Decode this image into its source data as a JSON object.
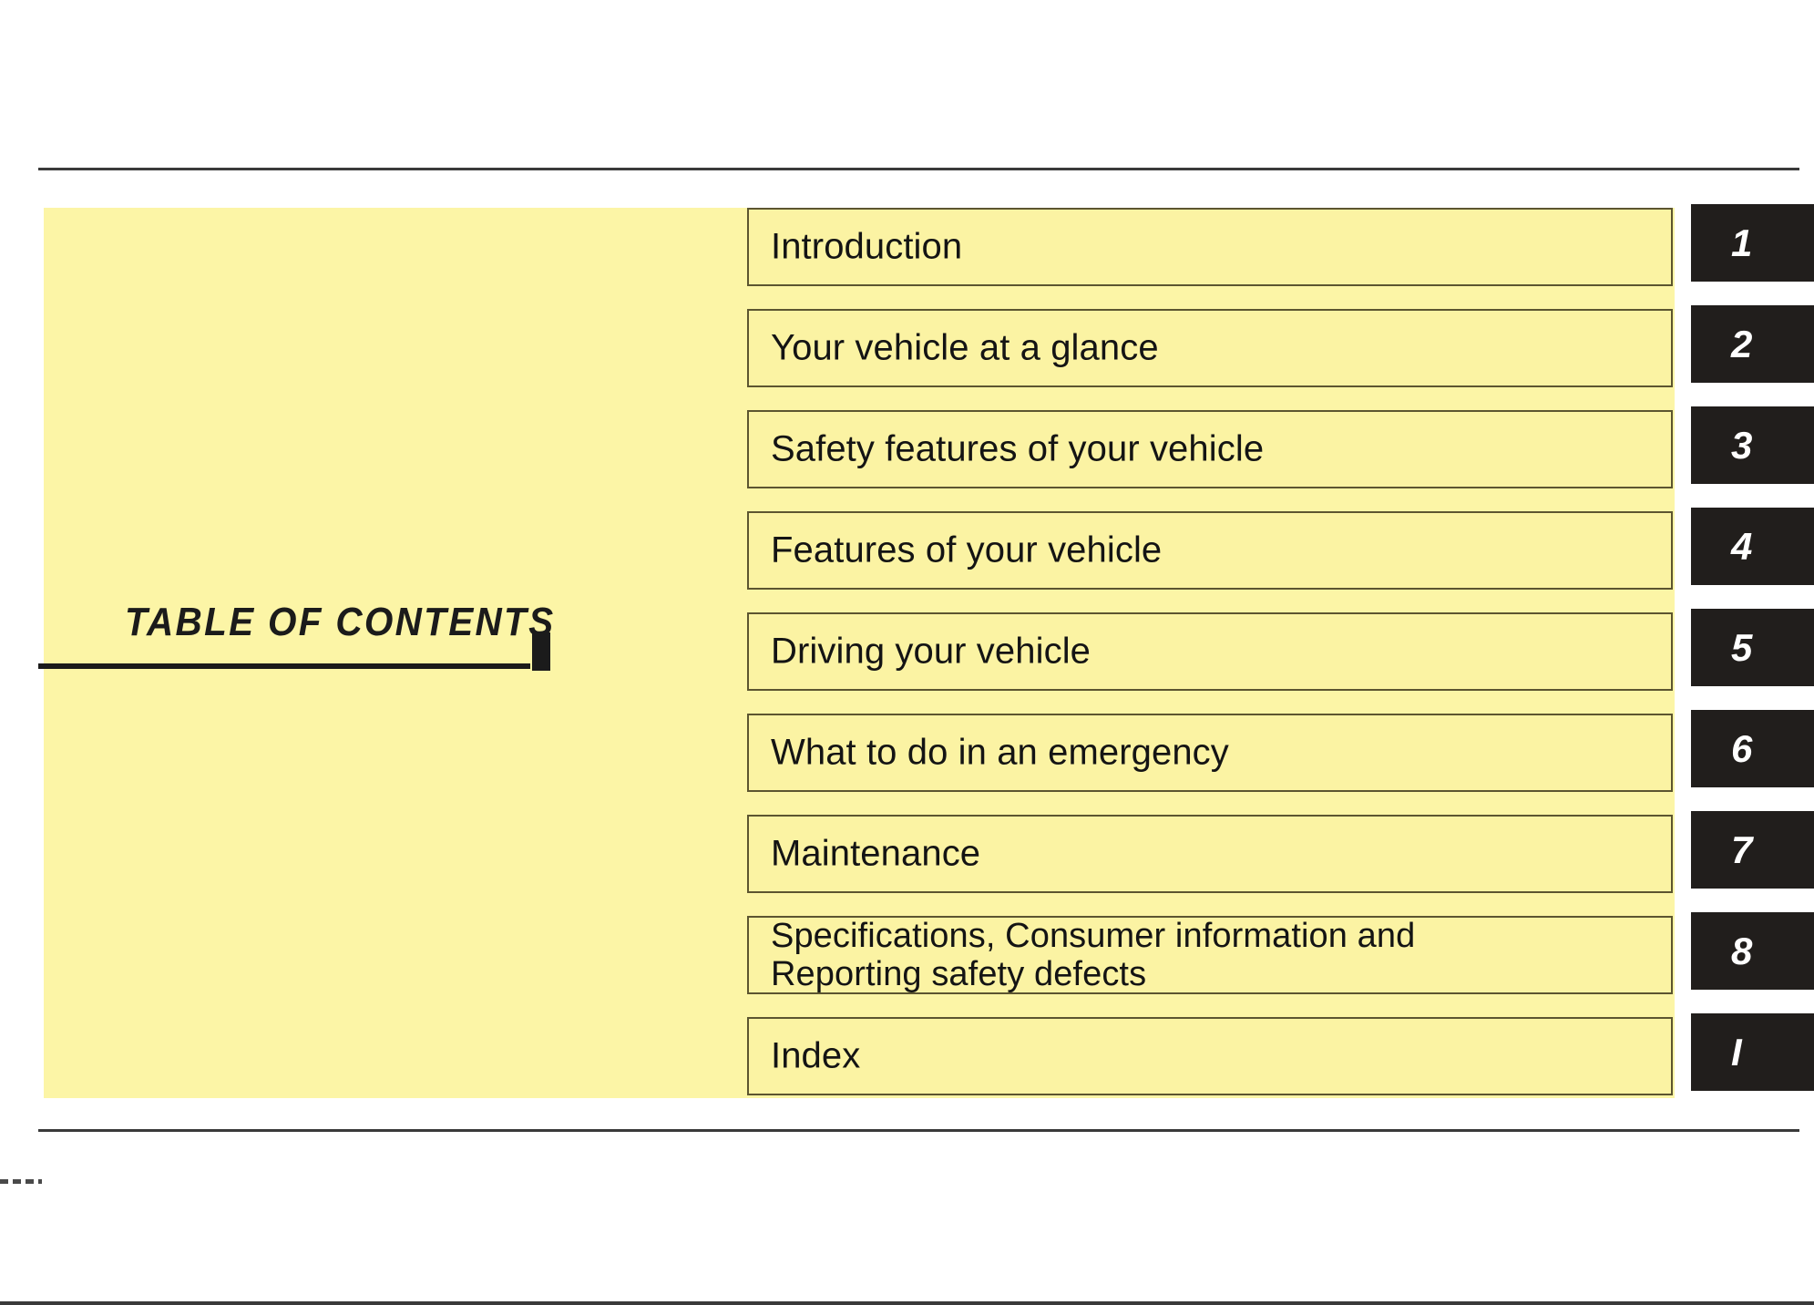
{
  "page": {
    "title": "TABLE OF CONTENTS",
    "panel_color": "#FCF5A6",
    "tab_color": "#211e1c",
    "rule_color": "#3a3a3a"
  },
  "toc": {
    "rows": [
      {
        "label": "Introduction",
        "tab": "1"
      },
      {
        "label": "Your vehicle at a glance",
        "tab": "2"
      },
      {
        "label": "Safety features of your vehicle",
        "tab": "3"
      },
      {
        "label": "Features of your vehicle",
        "tab": "4"
      },
      {
        "label": "Driving your vehicle",
        "tab": "5"
      },
      {
        "label": "What to do in an emergency",
        "tab": "6"
      },
      {
        "label": "Maintenance",
        "tab": "7"
      },
      {
        "label": "Specifications, Consumer information and\nReporting safety defects",
        "tab": "8"
      },
      {
        "label": "Index",
        "tab": "I"
      }
    ]
  }
}
